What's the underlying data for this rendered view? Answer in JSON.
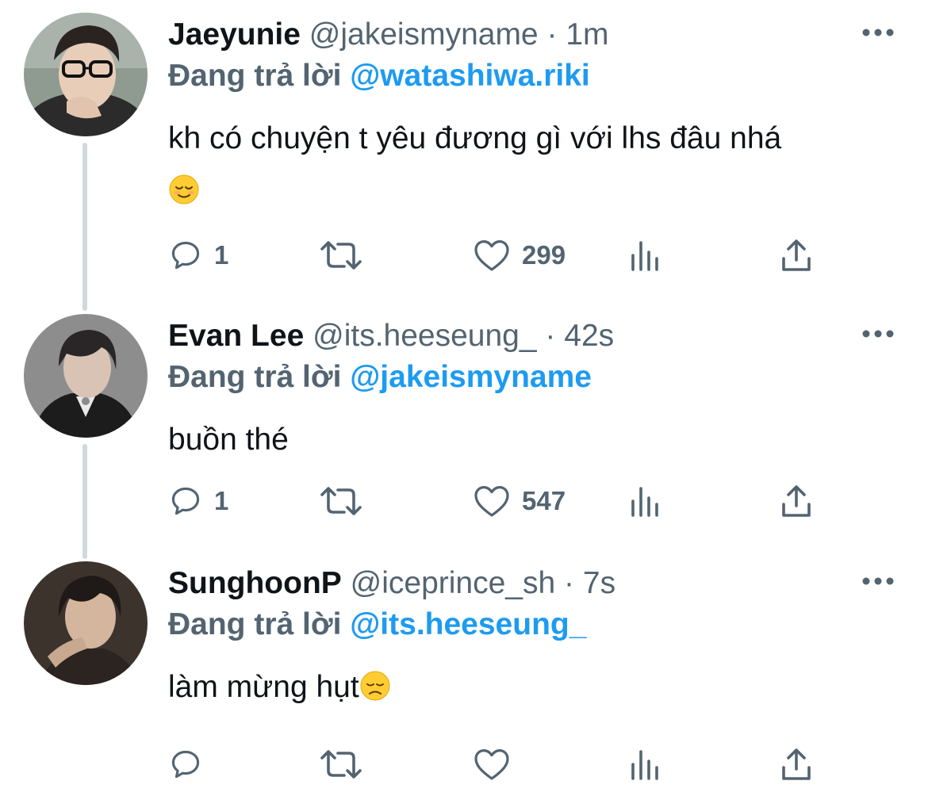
{
  "tweets": [
    {
      "display_name": "Jaeyunie",
      "handle": "@jakeismyname",
      "separator": "·",
      "time": "1m",
      "reply_prefix": "Đang trả lời",
      "reply_to": "@watashiwa.riki",
      "text": "kh có chuyện t yêu đương gì với lhs đâu nhá",
      "emoji": "relieved-face",
      "replies": "1",
      "retweets": "",
      "likes": "299"
    },
    {
      "display_name": "Evan Lee",
      "handle": "@its.heeseung_",
      "separator": "·",
      "time": "42s",
      "reply_prefix": "Đang trả lời",
      "reply_to": "@jakeismyname",
      "text": "buồn thé",
      "replies": "1",
      "retweets": "",
      "likes": "547"
    },
    {
      "display_name": "SunghoonP",
      "handle": "@iceprince_sh",
      "separator": "·",
      "time": "7s",
      "reply_prefix": "Đang trả lời",
      "reply_to": "@its.heeseung_",
      "text": "làm mừng hụt",
      "emoji": "disappointed-face",
      "replies": "",
      "retweets": "",
      "likes": ""
    }
  ],
  "icons": {
    "reply": "speech-bubble-icon",
    "retweet": "retweet-arrows-icon",
    "like": "heart-icon",
    "views": "bar-chart-icon",
    "share": "share-upload-icon",
    "more": "ellipsis-icon"
  },
  "colors": {
    "text": "#0f1419",
    "secondary": "#536471",
    "mention": "#1d9bf0",
    "thread_line": "#cfd9de",
    "emoji": "#ffcc33"
  }
}
